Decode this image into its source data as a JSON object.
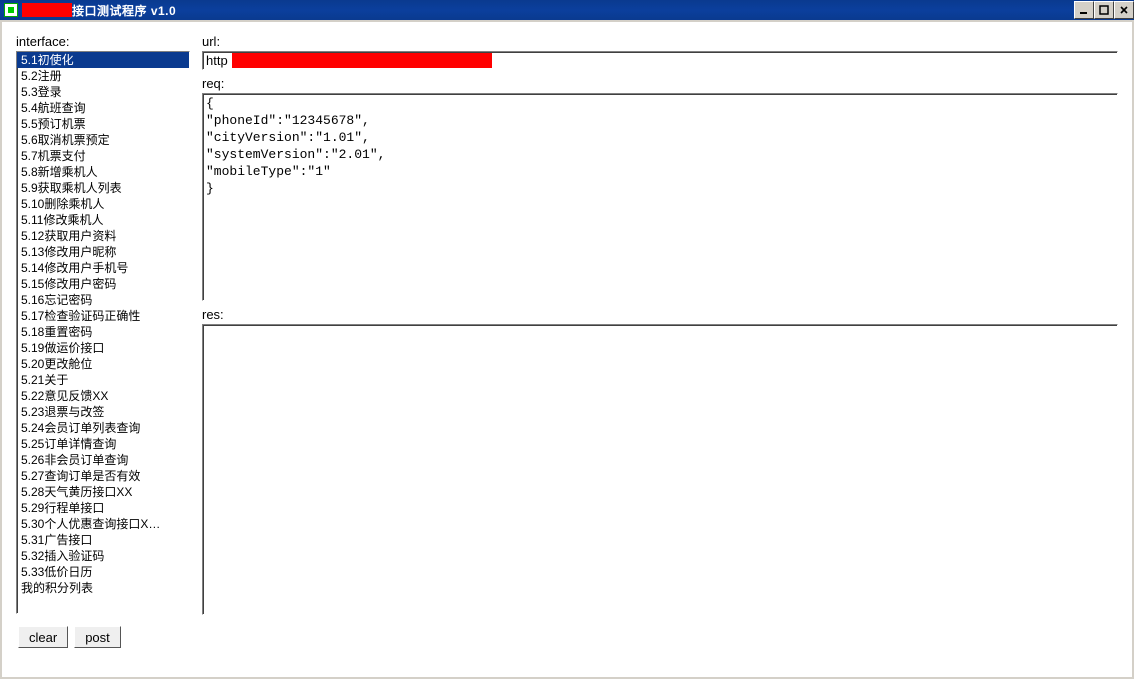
{
  "window": {
    "title_suffix": "接口测试程序  v1.0"
  },
  "labels": {
    "interface": "interface:",
    "url": "url:",
    "req": "req:",
    "res": "res:"
  },
  "interface_list": {
    "selected_index": 0,
    "items": [
      "5.1初使化",
      "5.2注册",
      "5.3登录",
      "5.4航班查询",
      "5.5预订机票",
      "5.6取消机票预定",
      "5.7机票支付",
      "5.8新增乘机人",
      "5.9获取乘机人列表",
      "5.10删除乘机人",
      "5.11修改乘机人",
      "5.12获取用户资料",
      "5.13修改用户昵称",
      "5.14修改用户手机号",
      "5.15修改用户密码",
      "5.16忘记密码",
      "5.17检查验证码正确性",
      "5.18重置密码",
      "5.19做运价接口",
      "5.20更改舱位",
      "5.21关于",
      "5.22意见反馈XX",
      "5.23退票与改签",
      "5.24会员订单列表查询",
      "5.25订单详情查询",
      "5.26非会员订单查询",
      "5.27查询订单是否有效",
      "5.28天气黄历接口XX",
      "5.29行程单接口",
      "5.30个人优惠查询接口X…",
      "5.31广告接口",
      "5.32插入验证码",
      "5.33低价日历",
      "我的积分列表"
    ]
  },
  "url": {
    "value_visible_prefix": "http"
  },
  "req": {
    "value": "{\n\"phoneId\":\"12345678\",\n\"cityVersion\":\"1.01\",\n\"systemVersion\":\"2.01\",\n\"mobileType\":\"1\"\n}"
  },
  "res": {
    "value": ""
  },
  "buttons": {
    "clear": "clear",
    "post": "post"
  }
}
